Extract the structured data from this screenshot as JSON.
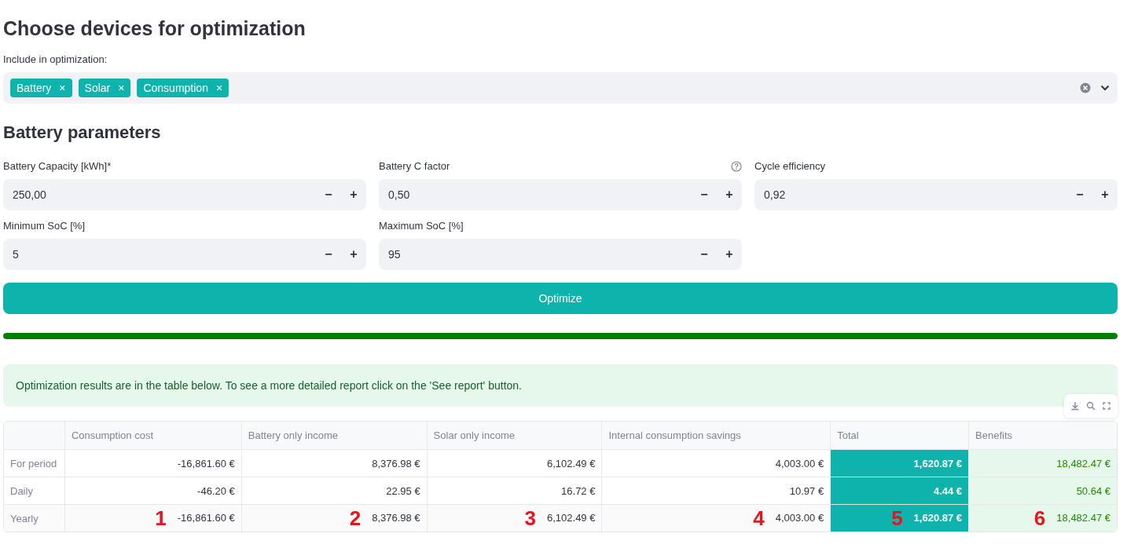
{
  "title": "Choose devices for optimization",
  "multiselect": {
    "label": "Include in optimization:",
    "tags": [
      {
        "label": "Battery",
        "remove": "×"
      },
      {
        "label": "Solar",
        "remove": "×"
      },
      {
        "label": "Consumption",
        "remove": "×"
      }
    ]
  },
  "section_title": "Battery parameters",
  "inputs": [
    {
      "label": "Battery Capacity [kWh]*",
      "value": "250,00",
      "help": false,
      "minus": "−",
      "plus": "+"
    },
    {
      "label": "Battery C factor",
      "value": "0,50",
      "help": true,
      "minus": "−",
      "plus": "+"
    },
    {
      "label": "Cycle efficiency",
      "value": "0,92",
      "help": false,
      "minus": "−",
      "plus": "+"
    },
    {
      "label": "Minimum SoC [%]",
      "value": "5",
      "help": false,
      "minus": "−",
      "plus": "+"
    },
    {
      "label": "Maximum SoC [%]",
      "value": "95",
      "help": false,
      "minus": "−",
      "plus": "+"
    }
  ],
  "optimize_button": "Optimize",
  "progress": {
    "level": 1
  },
  "alert": "Optimization results are in the table below. To see a more detailed report click on the 'See report' button.",
  "table": {
    "columns": [
      "Consumption cost",
      "Battery only income",
      "Solar only income",
      "Internal consumption savings",
      "Total",
      "Benefits"
    ],
    "rows": [
      {
        "label": "For period",
        "cells": [
          "-16,861.60 €",
          "8,376.98 €",
          "6,102.49 €",
          "4,003.00 €",
          "1,620.87 €",
          "18,482.47 €"
        ]
      },
      {
        "label": "Daily",
        "cells": [
          "-46.20 €",
          "22.95 €",
          "16.72 €",
          "10.97 €",
          "4.44 €",
          "50.64 €"
        ]
      },
      {
        "label": "Yearly",
        "cells": [
          "-16,861.60 €",
          "8,376.98 €",
          "6,102.49 €",
          "4,003.00 €",
          "1,620.87 €",
          "18,482.47 €"
        ],
        "markers": [
          "1",
          "2",
          "3",
          "4",
          "5",
          "6"
        ]
      }
    ]
  }
}
